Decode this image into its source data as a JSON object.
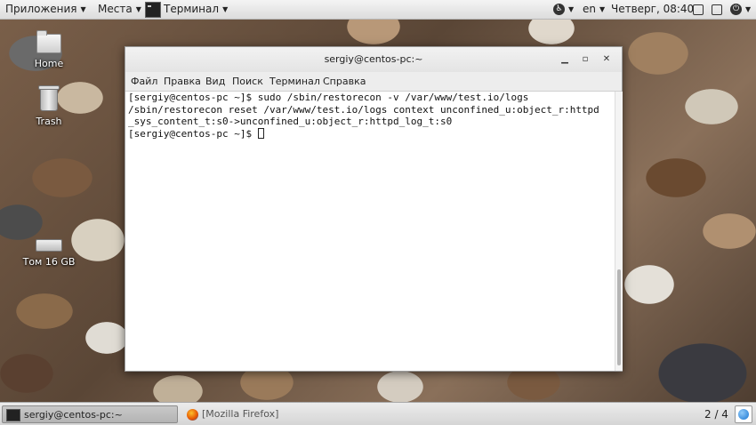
{
  "top_panel": {
    "apps_label": "Приложения",
    "places_label": "Места",
    "terminal_task_label": "Терминал",
    "lang": "en",
    "clock": "Четверг, 08:40"
  },
  "desktop_icons": {
    "home": "Home",
    "trash": "Trash",
    "volume": "Том 16 GB"
  },
  "terminal": {
    "title": "sergiy@centos-pc:~",
    "menu": [
      "Файл",
      "Правка",
      "Вид",
      "Поиск",
      "Терминал",
      "Справка"
    ],
    "lines": [
      "[sergiy@centos-pc ~]$ sudo /sbin/restorecon -v /var/www/test.io/logs",
      "/sbin/restorecon reset /var/www/test.io/logs context unconfined_u:object_r:httpd",
      "_sys_content_t:s0->unconfined_u:object_r:httpd_log_t:s0",
      "[sergiy@centos-pc ~]$ "
    ]
  },
  "bottom_panel": {
    "tasks": [
      "sergiy@centos-pc:~",
      "[Mozilla Firefox]"
    ],
    "workspace": "2 / 4"
  },
  "icons": {
    "accessibility": "accessibility-icon",
    "volume": "volume-icon",
    "network": "network-icon",
    "power": "power-icon"
  }
}
